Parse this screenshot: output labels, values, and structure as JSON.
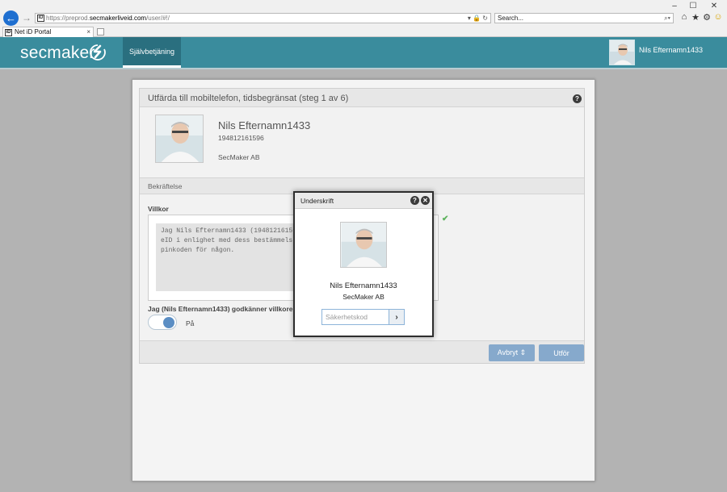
{
  "browser": {
    "address_scheme": "https://",
    "address_pre": "preprod.",
    "address_host": "secmakerliveid.com",
    "address_path": "/user/#!/",
    "address_tools": "▾ 🔒 ↻",
    "search_placeholder": "Search...",
    "tab_title": "Net iD Portal",
    "tab_close": "×",
    "favicon_label": "iD"
  },
  "header": {
    "logo_text": "secmaker",
    "nav_item": "Självbetjäning",
    "user_name": "Nils Efternamn1433",
    "accent_color": "#3a8c9d"
  },
  "card": {
    "title": "Utfärda till mobiltelefon, tidsbegränsat (steg 1 av 6)",
    "profile_name": "Nils Efternamn1433",
    "profile_id": "194812161596",
    "profile_org": "SecMaker AB",
    "section_title": "Bekräftelse",
    "villkor_label": "Villkor",
    "terms_text": "Jag Nils Efternamn1433 (19481216159\neID i enlighet med dess bestämmels\npinkoden för någon.",
    "accept_label": "Jag (Nils Efternamn1433) godkänner villkoren.",
    "toggle_state": "På",
    "cancel_button": "Avbryt ⇕",
    "run_button": "Utför"
  },
  "modal": {
    "title": "Underskrift",
    "name": "Nils Efternamn1433",
    "org": "SecMaker AB",
    "code_placeholder": "Säkerhetskod",
    "submit_icon": "chevron-right-icon"
  }
}
